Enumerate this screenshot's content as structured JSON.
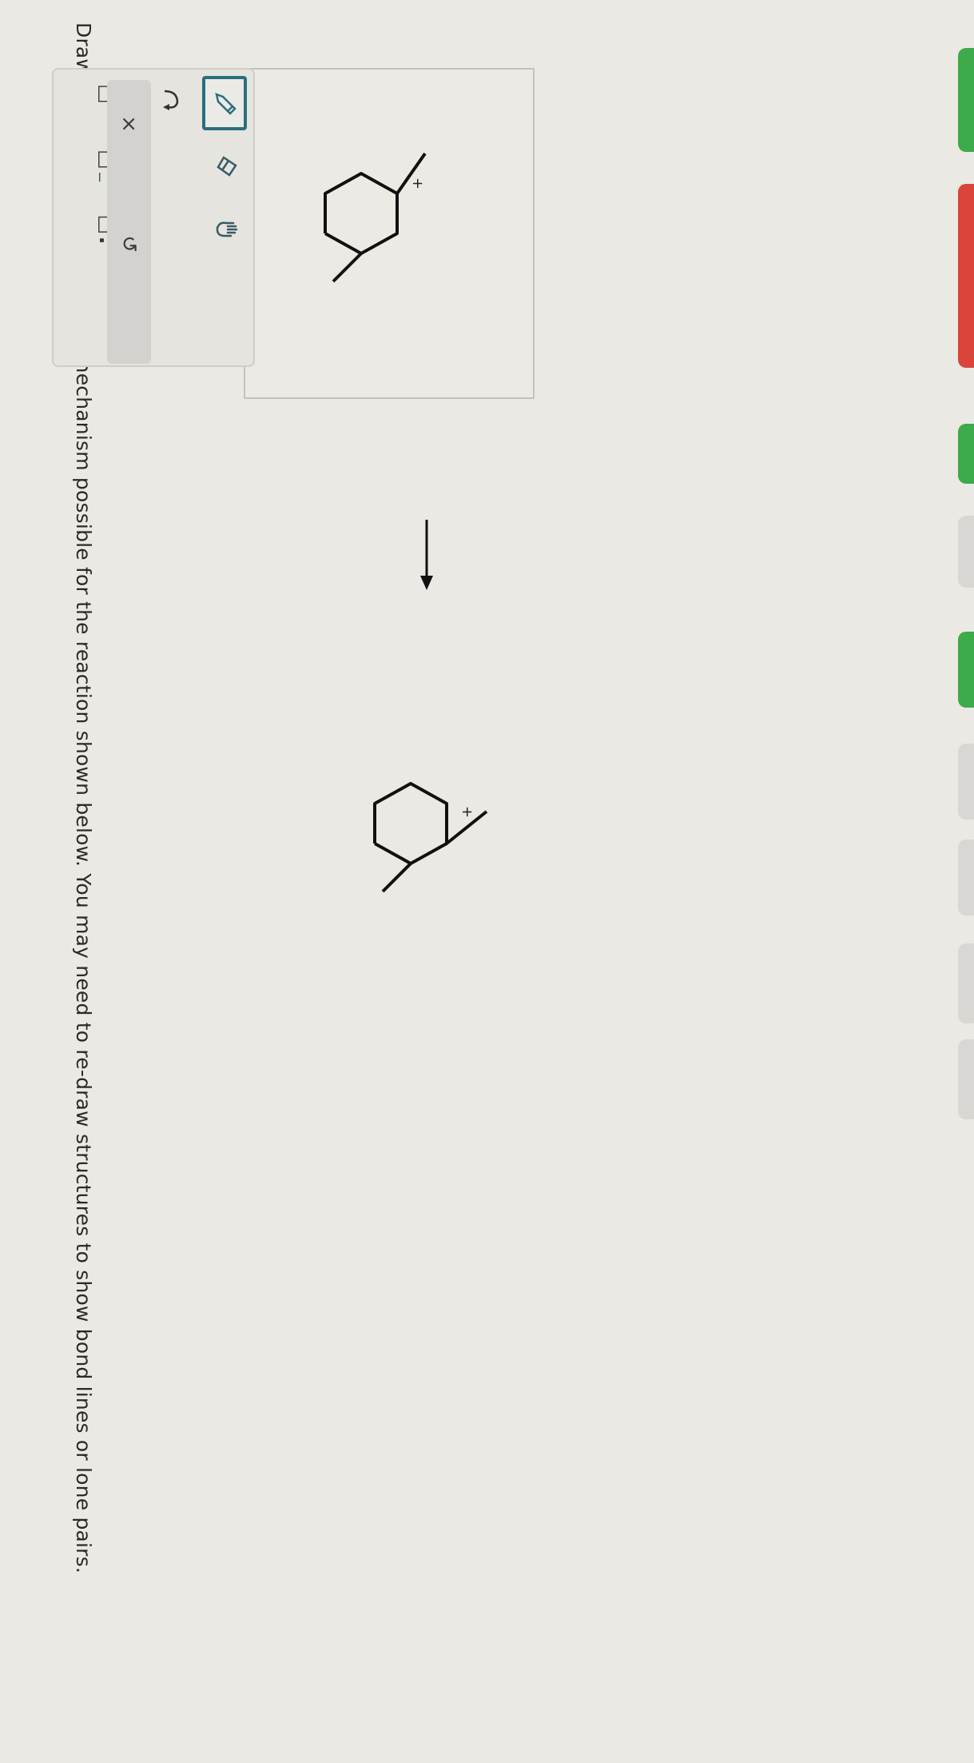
{
  "question": {
    "text": "Draw the simplest curved arrow mechanism possible for the reaction shown below. You may need to re-draw structures to show bond lines or lone pairs."
  },
  "reactant": {
    "charge_label": "+"
  },
  "product": {
    "charge_label": "+"
  },
  "toolbar": {
    "tools": [
      {
        "name": "pencil-tool",
        "icon": "pencil-icon",
        "selected": true
      },
      {
        "name": "eraser-tool",
        "icon": "eraser-icon"
      },
      {
        "name": "hand-tool",
        "icon": "hand-icon"
      },
      {
        "name": "curved-arrow-tool",
        "icon": "curved-arrow-icon"
      },
      {
        "name": "positive-charge-tool",
        "icon": "box-plus-icon"
      },
      {
        "name": "negative-charge-tool",
        "icon": "box-minus-icon"
      },
      {
        "name": "lone-pair-tool",
        "icon": "box-lone-pair-icon"
      }
    ],
    "plus_sup": "+",
    "minus_sub": "−",
    "clear_label": "×",
    "undo_label": "↺"
  },
  "colors": {
    "accent": "#2a6f7d",
    "green_tab": "#3daa4c",
    "red_tab": "#d9453b"
  }
}
